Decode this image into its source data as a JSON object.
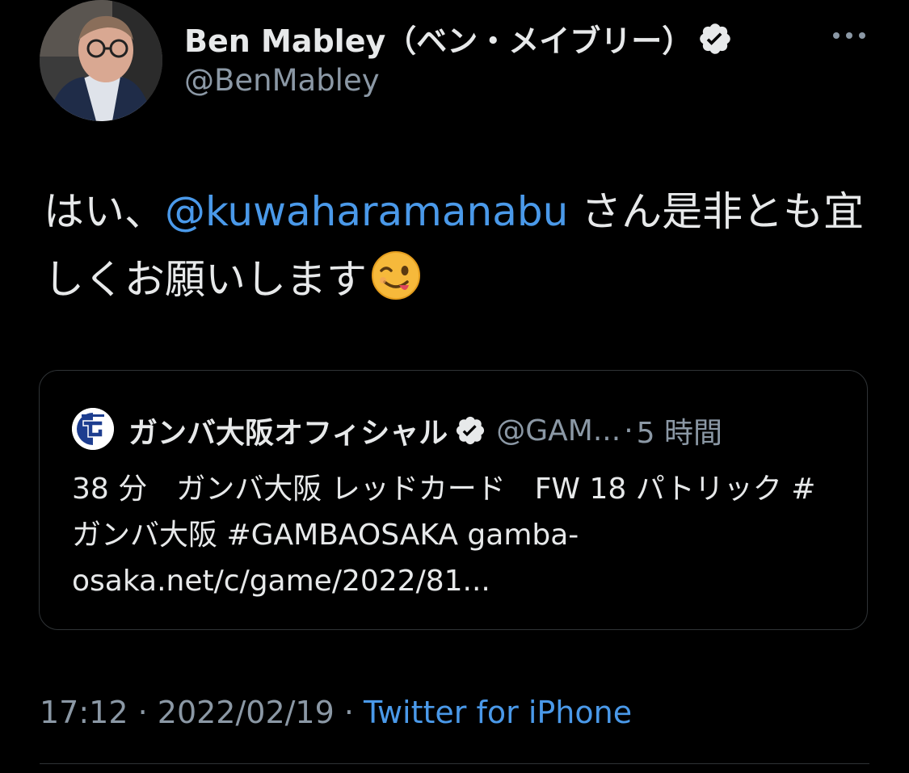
{
  "author": {
    "display_name": "Ben Mabley（ベン・メイブリー）",
    "handle": "@BenMabley",
    "verified": true
  },
  "tweet": {
    "text_before": "はい、",
    "mention": "@kuwaharamanabu",
    "text_after": " さん是非とも宜しくお願いします",
    "emoji": "winking-face"
  },
  "quoted_tweet": {
    "display_name": "ガンバ大阪オフィシャル",
    "handle": "@GAM...",
    "separator": "·",
    "time": "5 時間",
    "text": "38 分　ガンバ大阪 レッドカード　FW 18 パトリック #ガンバ大阪 #GAMBAOSAKA gamba-osaka.net/c/game/2022/81...",
    "avatar_icon": "gamba-osaka-logo"
  },
  "meta": {
    "time": "17:12",
    "separator": " · ",
    "date": "2022/02/19",
    "source": "Twitter for iPhone"
  },
  "colors": {
    "background": "#000000",
    "text": "#e7e9ea",
    "secondary": "#8b98a5",
    "link": "#4a99e9",
    "border": "#2f3336"
  }
}
